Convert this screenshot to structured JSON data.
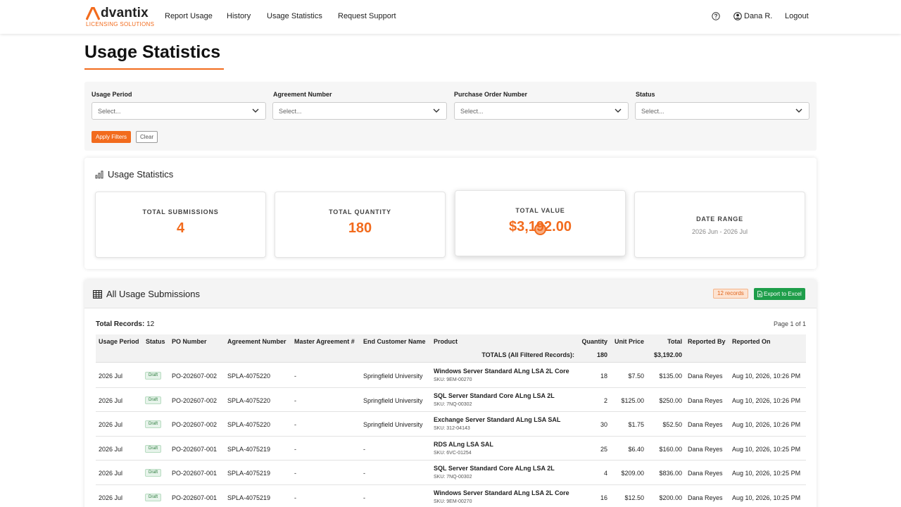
{
  "brand": {
    "name": "dvantix",
    "tagline": "LICENSING SOLUTIONS"
  },
  "nav": {
    "links": [
      "Report Usage",
      "History",
      "Usage Statistics",
      "Request Support"
    ],
    "user": "Dana R.",
    "logout": "Logout"
  },
  "page": {
    "title": "Usage Statistics"
  },
  "filters": {
    "usage_period": {
      "label": "Usage Period",
      "placeholder": "Select..."
    },
    "agreement_number": {
      "label": "Agreement Number",
      "placeholder": "Select..."
    },
    "po_number": {
      "label": "Purchase Order Number",
      "placeholder": "Select..."
    },
    "status": {
      "label": "Status",
      "placeholder": "Select..."
    },
    "apply_label": "Apply Filters",
    "clear_label": "Clear"
  },
  "stats": {
    "heading": "Usage Statistics",
    "total_submissions": {
      "label": "TOTAL SUBMISSIONS",
      "value": "4"
    },
    "total_quantity": {
      "label": "TOTAL QUANTITY",
      "value": "180"
    },
    "total_value": {
      "label": "TOTAL VALUE",
      "value": "$3,192.00"
    },
    "date_range": {
      "label": "DATE RANGE",
      "value": "2026 Jun - 2026 Jul"
    }
  },
  "submissions": {
    "title": "All Usage Submissions",
    "records_badge": "12 records",
    "export_label": "Export to Excel",
    "total_records_label": "Total Records:",
    "total_records_value": "12",
    "page_info": "Page 1 of 1",
    "columns": [
      "Usage Period",
      "Status",
      "PO Number",
      "Agreement Number",
      "Master Agreement #",
      "End Customer Name",
      "Product",
      "Quantity",
      "Unit Price",
      "Total",
      "Reported By",
      "Reported On"
    ],
    "totals": {
      "label": "TOTALS (All Filtered Records):",
      "quantity": "180",
      "total": "$3,192.00"
    },
    "rows": [
      {
        "period": "2026 Jul",
        "status": "Draft",
        "po": "PO-202607-002",
        "agreement": "SPLA-4075220",
        "master": "-",
        "customer": "Springfield University",
        "product": "Windows Server Standard ALng LSA 2L Core",
        "sku": "SKU: 9EM-00270",
        "qty": "18",
        "unit": "$7.50",
        "total": "$135.00",
        "by": "Dana Reyes",
        "on": "Aug 10, 2026, 10:26 PM"
      },
      {
        "period": "2026 Jul",
        "status": "Draft",
        "po": "PO-202607-002",
        "agreement": "SPLA-4075220",
        "master": "-",
        "customer": "Springfield University",
        "product": "SQL Server Standard Core ALng LSA 2L",
        "sku": "SKU: 7NQ-00302",
        "qty": "2",
        "unit": "$125.00",
        "total": "$250.00",
        "by": "Dana Reyes",
        "on": "Aug 10, 2026, 10:26 PM"
      },
      {
        "period": "2026 Jul",
        "status": "Draft",
        "po": "PO-202607-002",
        "agreement": "SPLA-4075220",
        "master": "-",
        "customer": "Springfield University",
        "product": "Exchange Server Standard ALng LSA SAL",
        "sku": "SKU: 312-04143",
        "qty": "30",
        "unit": "$1.75",
        "total": "$52.50",
        "by": "Dana Reyes",
        "on": "Aug 10, 2026, 10:26 PM"
      },
      {
        "period": "2026 Jul",
        "status": "Draft",
        "po": "PO-202607-001",
        "agreement": "SPLA-4075219",
        "master": "-",
        "customer": "-",
        "product": "RDS ALng LSA SAL",
        "sku": "SKU: 6VC-01254",
        "qty": "25",
        "unit": "$6.40",
        "total": "$160.00",
        "by": "Dana Reyes",
        "on": "Aug 10, 2026, 10:25 PM"
      },
      {
        "period": "2026 Jul",
        "status": "Draft",
        "po": "PO-202607-001",
        "agreement": "SPLA-4075219",
        "master": "-",
        "customer": "-",
        "product": "SQL Server Standard Core ALng LSA 2L",
        "sku": "SKU: 7NQ-00302",
        "qty": "4",
        "unit": "$209.00",
        "total": "$836.00",
        "by": "Dana Reyes",
        "on": "Aug 10, 2026, 10:25 PM"
      },
      {
        "period": "2026 Jul",
        "status": "Draft",
        "po": "PO-202607-001",
        "agreement": "SPLA-4075219",
        "master": "-",
        "customer": "-",
        "product": "Windows Server Standard ALng LSA 2L Core",
        "sku": "SKU: 9EM-00270",
        "qty": "16",
        "unit": "$12.50",
        "total": "$200.00",
        "by": "Dana Reyes",
        "on": "Aug 10, 2026, 10:25 PM"
      }
    ]
  },
  "colors": {
    "accent": "#f26b1d",
    "success": "#1e9e4a"
  }
}
